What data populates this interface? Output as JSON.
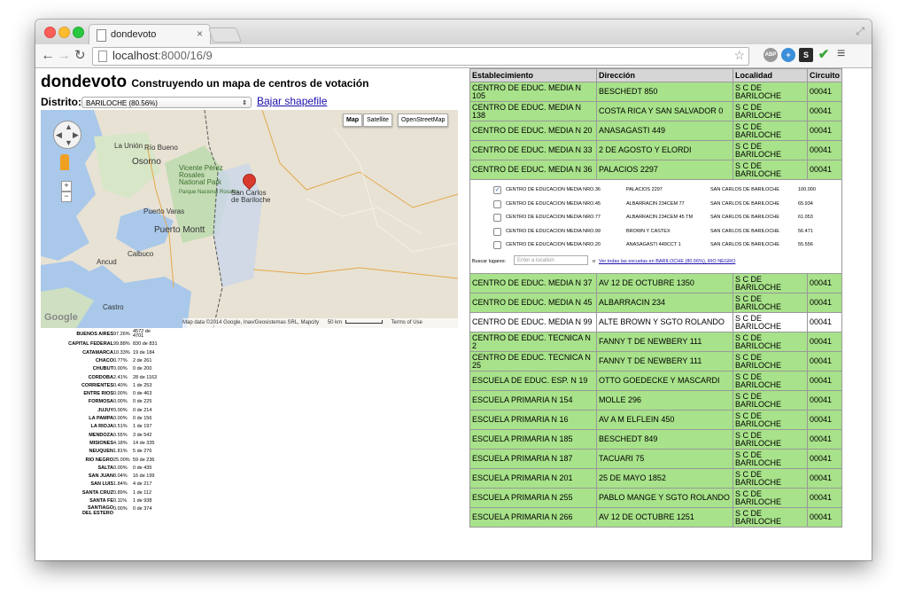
{
  "browser": {
    "tab_title": "dondevoto",
    "tab_close": "×",
    "url_host": "localhost",
    "url_path": ":8000/16/9",
    "extensions": [
      "adblock-icon",
      "globe-icon",
      "s-extension-icon",
      "check-icon"
    ],
    "abp_text": "ABP",
    "s_text": "S"
  },
  "header": {
    "title": "dondevoto",
    "subtitle": "Construyendo un mapa de centros de votación",
    "distrito_label": "Distrito:",
    "distrito_value": "BARILOCHE (80.56%)",
    "shapefile_link": "Bajar shapefile"
  },
  "map": {
    "types": [
      "Map",
      "Satellite",
      "OpenStreetMap"
    ],
    "places": [
      "La Unión",
      "Río Bueno",
      "Osorno",
      "Vicente Pérez Rosales National Park",
      "Parque Nacional Rosales",
      "San Carlos de Bariloche",
      "Puerto Varas",
      "Puerto Montt",
      "Calbuco",
      "Ancud",
      "Castro"
    ],
    "attribution": "Map data ©2014 Google, Inav/Geosistemas SRL, Mapcity",
    "scale": "50 km",
    "terms": "Terms of Use",
    "logo": "Google",
    "zoom_in": "+",
    "zoom_out": "−"
  },
  "stats": [
    {
      "name": "BUENOS AIRES",
      "pct": "97.26%",
      "count": "4572 de 4701"
    },
    {
      "name": "CAPITAL FEDERAL",
      "pct": "99.88%",
      "count": "830 de 831"
    },
    {
      "name": "CATAMARCA",
      "pct": "10.33%",
      "count": "19 de 184"
    },
    {
      "name": "CHACO",
      "pct": "0.77%",
      "count": "2 de 261"
    },
    {
      "name": "CHUBUT",
      "pct": "0.00%",
      "count": "0 de 200"
    },
    {
      "name": "CORDOBA",
      "pct": "2.41%",
      "count": "28 de 1163"
    },
    {
      "name": "CORRIENTES",
      "pct": "0.40%",
      "count": "1 de 253"
    },
    {
      "name": "ENTRE RIOS",
      "pct": "0.00%",
      "count": "0 de 463"
    },
    {
      "name": "FORMOSA",
      "pct": "0.00%",
      "count": "0 de 225"
    },
    {
      "name": "JUJUY",
      "pct": "0.00%",
      "count": "0 de 214"
    },
    {
      "name": "LA PAMPA",
      "pct": "0.00%",
      "count": "0 de 156"
    },
    {
      "name": "LA RIOJA",
      "pct": "0.51%",
      "count": "1 de 197"
    },
    {
      "name": "MENDOZA",
      "pct": "0.55%",
      "count": "3 de 542"
    },
    {
      "name": "MISIONES",
      "pct": "4.18%",
      "count": "14 de 335"
    },
    {
      "name": "NEUQUEN",
      "pct": "1.81%",
      "count": "5 de 276"
    },
    {
      "name": "RIO NEGRO",
      "pct": "25.00%",
      "count": "59 de 236"
    },
    {
      "name": "SALTA",
      "pct": "0.00%",
      "count": "0 de 435"
    },
    {
      "name": "SAN JUAN",
      "pct": "8.04%",
      "count": "16 de 199"
    },
    {
      "name": "SAN LUIS",
      "pct": "1.84%",
      "count": "4 de 217"
    },
    {
      "name": "SANTA CRUZ",
      "pct": "0.89%",
      "count": "1 de 112"
    },
    {
      "name": "SANTA FE",
      "pct": "0.11%",
      "count": "1 de 938"
    },
    {
      "name": "SANTIAGO DEL ESTERO",
      "pct": "0.00%",
      "count": "0 de 374"
    }
  ],
  "table": {
    "headers": [
      "Establecimiento",
      "Dirección",
      "Localidad",
      "Circuito"
    ],
    "rows_top": [
      [
        "CENTRO DE EDUC. MEDIA N 105",
        "BESCHEDT 850",
        "S C DE BARILOCHE",
        "00041"
      ],
      [
        "CENTRO DE EDUC. MEDIA N 138",
        "COSTA RICA Y SAN SALVADOR 0",
        "S C DE BARILOCHE",
        "00041"
      ],
      [
        "CENTRO DE EDUC. MEDIA N 20",
        "ANASAGASTI 449",
        "S C DE BARILOCHE",
        "00041"
      ],
      [
        "CENTRO DE EDUC. MEDIA N 33",
        "2 DE AGOSTO Y ELORDI",
        "S C DE BARILOCHE",
        "00041"
      ],
      [
        "CENTRO DE EDUC. MEDIA N 36",
        "PALACIOS 2297",
        "S C DE BARILOCHE",
        "00041"
      ]
    ],
    "candidates": [
      {
        "checked": "✓",
        "name": "CENTRO DE EDUCACION MEDIA NRO.36",
        "addr": "PALACIOS 2297",
        "loc": "SAN CARLOS DE BARILOCHE",
        "score": "100.000"
      },
      {
        "checked": "",
        "name": "CENTRO DE EDUCACION MEDIA NRO.45",
        "addr": "ALBARRACIN 234CEM 77",
        "loc": "SAN CARLOS DE BARILOCHE",
        "score": "65.934"
      },
      {
        "checked": "",
        "name": "CENTRO DE EDUCACION MEDIA NRO.77",
        "addr": "ALBARRACIN 234CEM 45 TM",
        "loc": "SAN CARLOS DE BARILOCHE",
        "score": "61.053"
      },
      {
        "checked": "",
        "name": "CENTRO DE EDUCACION MEDIA NRO.99",
        "addr": "BROWN Y CASTEX",
        "loc": "SAN CARLOS DE BARILOCHE",
        "score": "56.471"
      },
      {
        "checked": "",
        "name": "CENTRO DE EDUCACION MEDIA NRO.20",
        "addr": "ANASAGASTI 449CCT 1",
        "loc": "SAN CARLOS DE BARILOCHE",
        "score": "55.556"
      }
    ],
    "search_label": "Buscar lugares:",
    "search_placeholder": "Enter a location",
    "search_or": "o",
    "search_link": "Ver todas las escuelas en BARILOCHE (80.56%), RIO NEGRO",
    "rows_bottom": [
      {
        "cells": [
          "CENTRO DE EDUC. MEDIA N 37",
          "AV 12 DE OCTUBRE 1350",
          "S C DE BARILOCHE",
          "00041"
        ],
        "color": "#a8e28a"
      },
      {
        "cells": [
          "CENTRO DE EDUC. MEDIA N 45",
          "ALBARRACIN 234",
          "S C DE BARILOCHE",
          "00041"
        ],
        "color": "#a8e28a"
      },
      {
        "cells": [
          "CENTRO DE EDUC. MEDIA N 99",
          "ALTE BROWN Y SGTO ROLANDO",
          "S C DE BARILOCHE",
          "00041"
        ],
        "color": "#ffffff"
      },
      {
        "cells": [
          "CENTRO DE EDUC. TECNICA N 2",
          "FANNY T DE NEWBERY 111",
          "S C DE BARILOCHE",
          "00041"
        ],
        "color": "#a8e28a"
      },
      {
        "cells": [
          "CENTRO DE EDUC. TECNICA N 25",
          "FANNY T DE NEWBERY 111",
          "S C DE BARILOCHE",
          "00041"
        ],
        "color": "#a8e28a"
      },
      {
        "cells": [
          "ESCUELA DE EDUC. ESP. N 19",
          "OTTO GOEDECKE Y MASCARDI",
          "S C DE BARILOCHE",
          "00041"
        ],
        "color": "#a8e28a"
      },
      {
        "cells": [
          "ESCUELA PRIMARIA N 154",
          "MOLLE 296",
          "S C DE BARILOCHE",
          "00041"
        ],
        "color": "#a8e28a"
      },
      {
        "cells": [
          "ESCUELA PRIMARIA N 16",
          "AV A M ELFLEIN 450",
          "S C DE BARILOCHE",
          "00041"
        ],
        "color": "#a8e28a"
      },
      {
        "cells": [
          "ESCUELA PRIMARIA N 185",
          "BESCHEDT 849",
          "S C DE BARILOCHE",
          "00041"
        ],
        "color": "#a8e28a"
      },
      {
        "cells": [
          "ESCUELA PRIMARIA N 187",
          "TACUARI 75",
          "S C DE BARILOCHE",
          "00041"
        ],
        "color": "#a8e28a"
      },
      {
        "cells": [
          "ESCUELA PRIMARIA N 201",
          "25 DE MAYO 1852",
          "S C DE BARILOCHE",
          "00041"
        ],
        "color": "#a8e28a"
      },
      {
        "cells": [
          "ESCUELA PRIMARIA N 255",
          "PABLO MANGE Y SGTO ROLANDO",
          "S C DE BARILOCHE",
          "00041"
        ],
        "color": "#a8e28a"
      },
      {
        "cells": [
          "ESCUELA PRIMARIA N 266",
          "AV 12 DE OCTUBRE 1251",
          "S C DE BARILOCHE",
          "00041"
        ],
        "color": "#a8e28a"
      }
    ]
  }
}
